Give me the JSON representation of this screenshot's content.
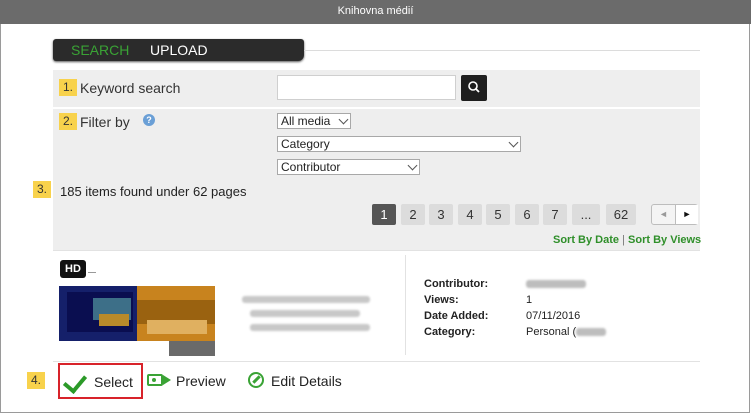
{
  "window": {
    "title": "Knihovna médií"
  },
  "tabs": {
    "search": "SEARCH",
    "upload": "UPLOAD"
  },
  "steps": {
    "s1": "1.",
    "s2": "2.",
    "s3": "3.",
    "s4": "4."
  },
  "keyword": {
    "label": "Keyword search",
    "value": "",
    "search_icon": "magnifier-icon"
  },
  "filter": {
    "label": "Filter by",
    "help_icon": "?",
    "media_type": "All media",
    "category": "Category",
    "contributor": "Contributor"
  },
  "results": {
    "summary": "185 items found under 62 pages",
    "pages": [
      "1",
      "2",
      "3",
      "4",
      "5",
      "6",
      "7",
      "...",
      "62"
    ],
    "current_page": "1",
    "prev": "◄",
    "next": "►",
    "sort_by_date": "Sort By Date",
    "sort_sep": "|",
    "sort_by_views": "Sort By Views"
  },
  "item": {
    "badge": "HD",
    "meta": {
      "contributor_label": "Contributor:",
      "views_label": "Views:",
      "views_value": "1",
      "date_label": "Date Added:",
      "date_value": "07/11/2016",
      "category_label": "Category:",
      "category_value": "Personal ("
    }
  },
  "actions": {
    "select": "Select",
    "preview": "Preview",
    "edit": "Edit Details"
  },
  "colors": {
    "accent_green": "#3aa335",
    "highlight_yellow": "#f8d24c",
    "select_border": "#d8232a"
  }
}
